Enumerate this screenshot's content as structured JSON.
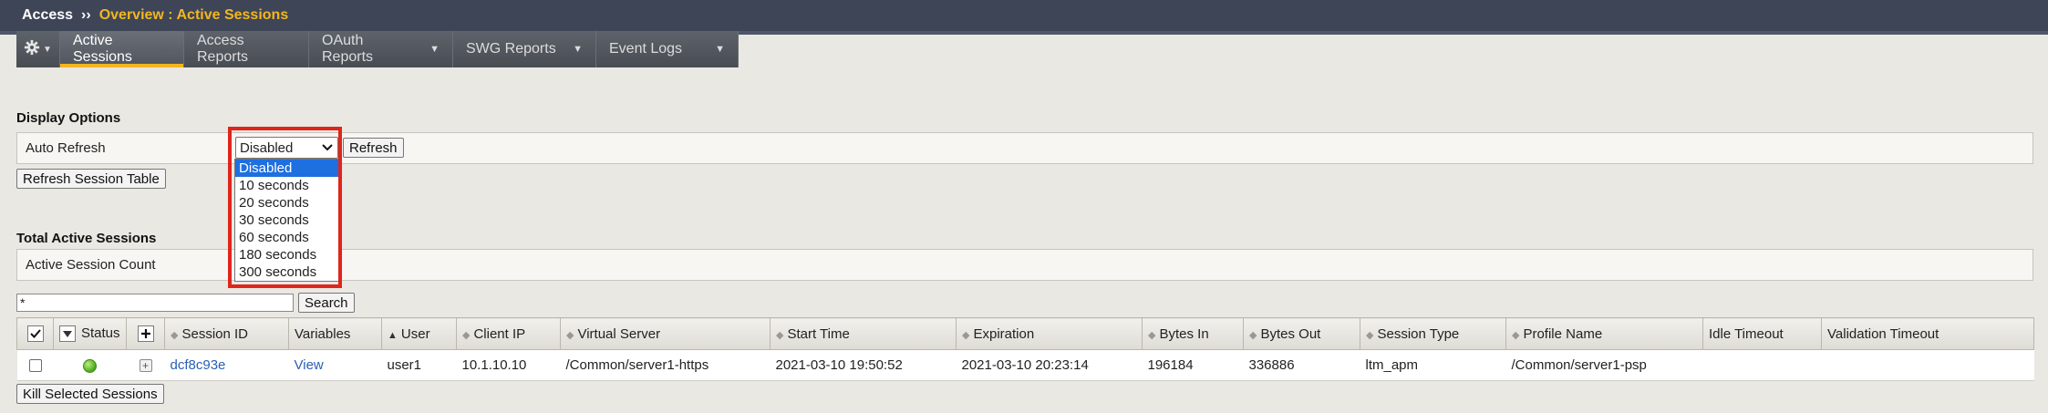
{
  "breadcrumb": {
    "root": "Access",
    "separator": "››",
    "current": "Overview : Active Sessions"
  },
  "tabs": [
    {
      "label": "Active Sessions",
      "active": true,
      "has_menu": false
    },
    {
      "label": "Access Reports",
      "active": false,
      "has_menu": false
    },
    {
      "label": "OAuth Reports",
      "active": false,
      "has_menu": true
    },
    {
      "label": "SWG Reports",
      "active": false,
      "has_menu": true
    },
    {
      "label": "Event Logs",
      "active": false,
      "has_menu": true
    }
  ],
  "display_options": {
    "title": "Display Options",
    "auto_refresh_label": "Auto Refresh",
    "selected": "Disabled",
    "options": [
      "Disabled",
      "10 seconds",
      "20 seconds",
      "30 seconds",
      "60 seconds",
      "180 seconds",
      "300 seconds"
    ],
    "refresh_button": "Refresh",
    "refresh_table_button": "Refresh Session Table"
  },
  "totals": {
    "title": "Total Active Sessions",
    "count_label": "Active Session Count"
  },
  "search": {
    "value": "*",
    "button": "Search"
  },
  "table": {
    "headers": {
      "status": "Status",
      "session_id": "Session ID",
      "variables": "Variables",
      "user": "User",
      "client_ip": "Client IP",
      "virtual_server": "Virtual Server",
      "start_time": "Start Time",
      "expiration": "Expiration",
      "bytes_in": "Bytes In",
      "bytes_out": "Bytes Out",
      "session_type": "Session Type",
      "profile_name": "Profile Name",
      "idle_timeout": "Idle Timeout",
      "validation_timeout": "Validation Timeout"
    },
    "rows": [
      {
        "session_id": "dcf8c93e",
        "variables": "View",
        "user": "user1",
        "client_ip": "10.1.10.10",
        "virtual_server": "/Common/server1-https",
        "start_time": "2021-03-10 19:50:52",
        "expiration": "2021-03-10 20:23:14",
        "bytes_in": "196184",
        "bytes_out": "336886",
        "session_type": "ltm_apm",
        "profile_name": "/Common/server1-psp",
        "idle_timeout": "",
        "validation_timeout": ""
      }
    ],
    "kill_button": "Kill Selected Sessions"
  },
  "colors": {
    "accent": "#f3b61f",
    "highlight": "#e0251b",
    "link": "#2a5fb3"
  }
}
